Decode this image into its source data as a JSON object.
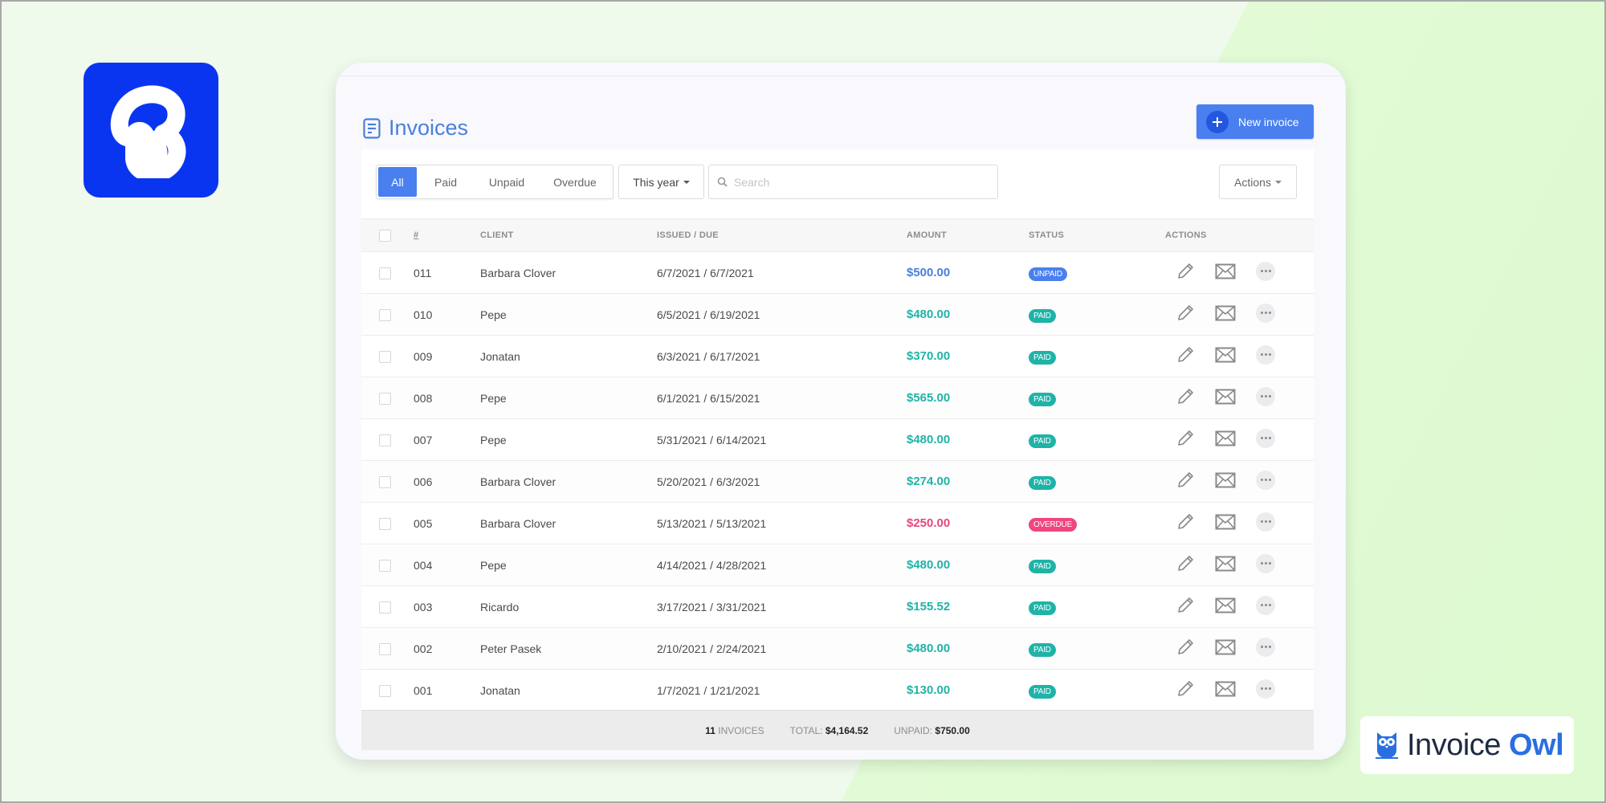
{
  "brand_logo": {
    "glyph": "B",
    "color": "#0a35f0"
  },
  "owl_badge": {
    "word1": "Invoice",
    "word2": "Owl",
    "icon": "owl-icon",
    "accent": "#2a6fe0"
  },
  "header": {
    "title": "Invoices",
    "title_icon": "document-icon",
    "new_invoice_label": "New invoice",
    "accent": "#4a7ff0"
  },
  "toolbar": {
    "filters": [
      {
        "label": "All",
        "active": true
      },
      {
        "label": "Paid",
        "active": false
      },
      {
        "label": "Unpaid",
        "active": false
      },
      {
        "label": "Overdue",
        "active": false
      }
    ],
    "period_value": "This year",
    "search_placeholder": "Search",
    "search_value": "",
    "actions_label": "Actions"
  },
  "table": {
    "columns": [
      "#",
      "Client",
      "Issued / Due",
      "Amount",
      "Status",
      "Actions"
    ],
    "rows": [
      {
        "num": "011",
        "client": "Barbara Clover",
        "dates": "6/7/2021 / 6/7/2021",
        "amount": "$500.00",
        "status": "UNPAID"
      },
      {
        "num": "010",
        "client": "Pepe",
        "dates": "6/5/2021 / 6/19/2021",
        "amount": "$480.00",
        "status": "PAID"
      },
      {
        "num": "009",
        "client": "Jonatan",
        "dates": "6/3/2021 / 6/17/2021",
        "amount": "$370.00",
        "status": "PAID"
      },
      {
        "num": "008",
        "client": "Pepe",
        "dates": "6/1/2021 / 6/15/2021",
        "amount": "$565.00",
        "status": "PAID"
      },
      {
        "num": "007",
        "client": "Pepe",
        "dates": "5/31/2021 / 6/14/2021",
        "amount": "$480.00",
        "status": "PAID"
      },
      {
        "num": "006",
        "client": "Barbara Clover",
        "dates": "5/20/2021 / 6/3/2021",
        "amount": "$274.00",
        "status": "PAID"
      },
      {
        "num": "005",
        "client": "Barbara Clover",
        "dates": "5/13/2021 / 5/13/2021",
        "amount": "$250.00",
        "status": "OVERDUE"
      },
      {
        "num": "004",
        "client": "Pepe",
        "dates": "4/14/2021 / 4/28/2021",
        "amount": "$480.00",
        "status": "PAID"
      },
      {
        "num": "003",
        "client": "Ricardo",
        "dates": "3/17/2021 / 3/31/2021",
        "amount": "$155.52",
        "status": "PAID"
      },
      {
        "num": "002",
        "client": "Peter Pasek",
        "dates": "2/10/2021 / 2/24/2021",
        "amount": "$480.00",
        "status": "PAID"
      },
      {
        "num": "001",
        "client": "Jonatan",
        "dates": "1/7/2021 / 1/21/2021",
        "amount": "$130.00",
        "status": "PAID"
      }
    ],
    "status_colors": {
      "PAID": "#1fb3a8",
      "UNPAID": "#4a7ff0",
      "OVERDUE": "#f0467e"
    },
    "amount_colors": {
      "PAID": "#20b3a6",
      "UNPAID": "#4a7fdc",
      "OVERDUE": "#e5487a"
    },
    "row_action_icons": [
      "pencil-icon",
      "envelope-icon",
      "more-icon"
    ]
  },
  "footer": {
    "count": "11",
    "count_label": "INVOICES",
    "total_label": "TOTAL:",
    "total_value": "$4,164.52",
    "unpaid_label": "UNPAID:",
    "unpaid_value": "$750.00"
  }
}
